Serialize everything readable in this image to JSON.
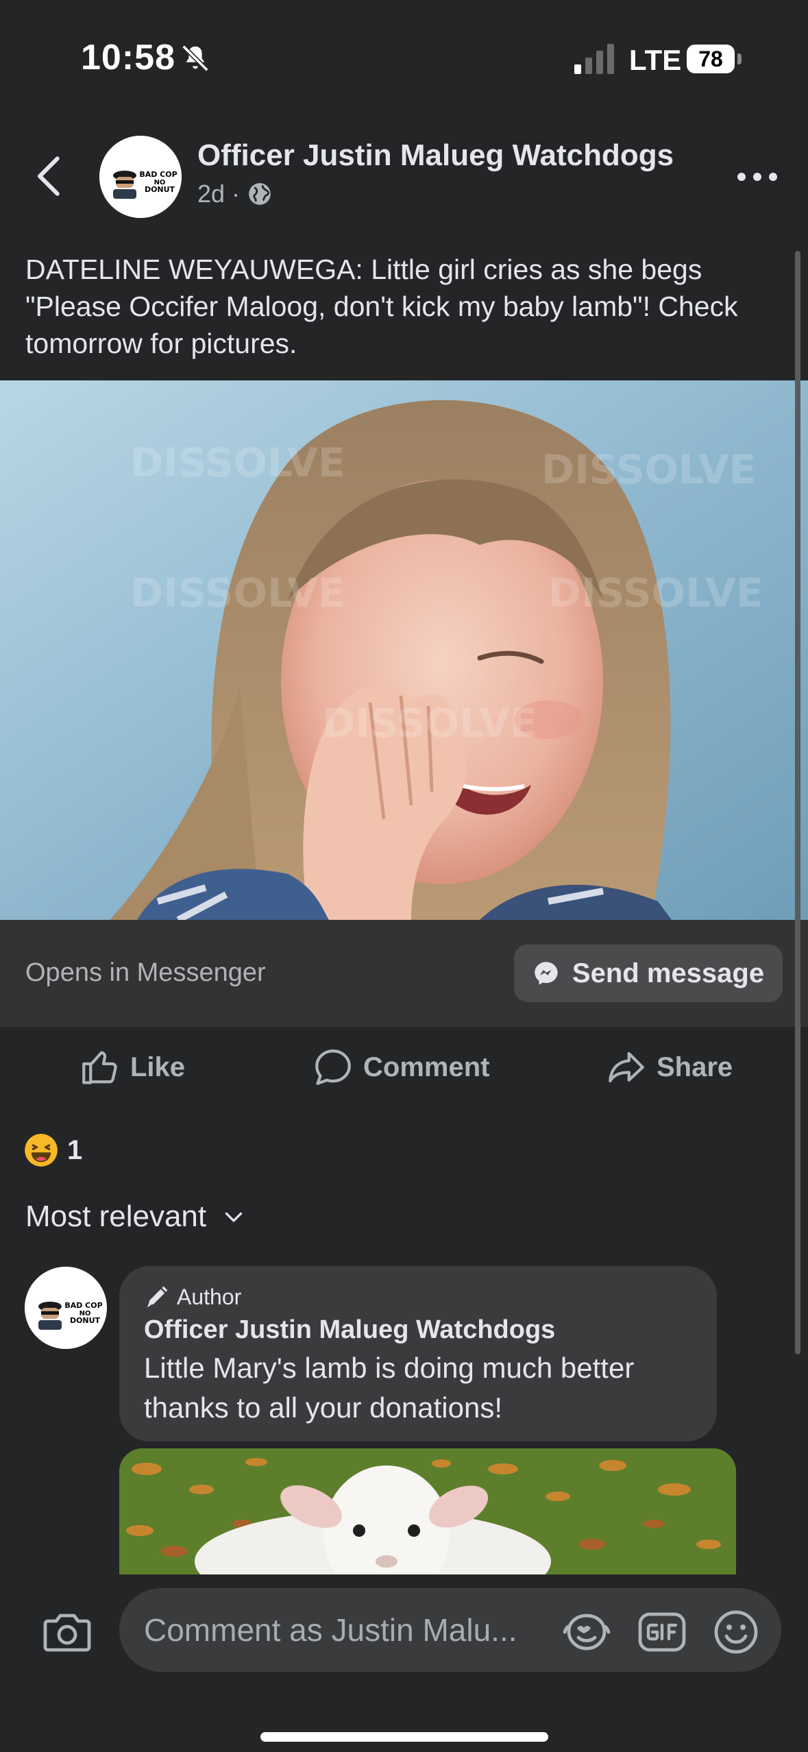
{
  "status_bar": {
    "time": "10:58",
    "network": "LTE",
    "battery": "78"
  },
  "post": {
    "page_name": "Officer Justin Malueg Watchdogs",
    "age": "2d",
    "separator": "·",
    "text": "DATELINE WEYAUWEGA: Little girl cries as she begs \"Please Occifer Maloog, don't kick my baby lamb\"! Check tomorrow for pictures.",
    "photo_watermark": "DISSOLVE"
  },
  "avatar_logo": {
    "line1": "BAD COP",
    "line2": "NO",
    "line3": "DONUT"
  },
  "messenger": {
    "label": "Opens in Messenger",
    "button_label": "Send message"
  },
  "actions": {
    "like": "Like",
    "comment": "Comment",
    "share": "Share"
  },
  "reactions": {
    "count": "1"
  },
  "comments": {
    "sort_label": "Most relevant",
    "items": [
      {
        "badge": "Author",
        "author": "Officer Justin Malueg Watchdogs",
        "text": "Little Mary's lamb is doing much better thanks to all your donations!"
      }
    ]
  },
  "composer": {
    "placeholder": "Comment as Justin Malu..."
  },
  "icons": {
    "back": "back-icon",
    "muted": "bell-slash-icon",
    "more": "more-icon",
    "globe": "globe-icon",
    "like": "thumbs-up-icon",
    "comment": "comment-icon",
    "share": "share-icon",
    "reaction": "haha-icon",
    "camera": "camera-icon",
    "gif": "gif-icon",
    "emoji": "emoji-icon"
  },
  "colors": {
    "background": "#242526",
    "surface": "#3a3b3c",
    "text": "#e4e6eb",
    "muted_text": "#b0b3b8",
    "haha_yellow": "#f7b928"
  }
}
